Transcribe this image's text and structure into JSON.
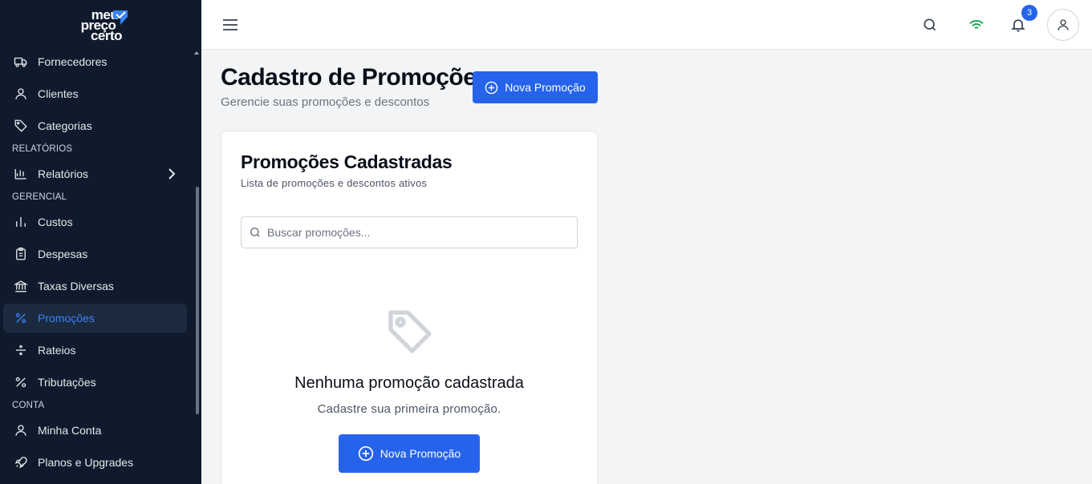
{
  "brand": {
    "line1": "meu",
    "line2": "preço",
    "line3": "certo"
  },
  "colors": {
    "sidebar": "#0f1b2d",
    "accent": "#2563eb",
    "active_text": "#3b82f6",
    "wifi": "#16a34a"
  },
  "sidebar": {
    "items": [
      {
        "label": "Fornecedores",
        "icon": "truck-icon"
      },
      {
        "label": "Clientes",
        "icon": "user-icon"
      },
      {
        "label": "Categorias",
        "icon": "tag-icon"
      },
      {
        "label": "Relatórios",
        "icon": "bar-chart-icon"
      },
      {
        "label": "Custos",
        "icon": "chart-icon"
      },
      {
        "label": "Despesas",
        "icon": "clipboard-icon"
      },
      {
        "label": "Taxas Diversas",
        "icon": "bank-icon"
      },
      {
        "label": "Promoções",
        "icon": "percent-icon",
        "active": true
      },
      {
        "label": "Rateios",
        "icon": "divide-icon"
      },
      {
        "label": "Tributações",
        "icon": "percent-icon"
      },
      {
        "label": "Minha Conta",
        "icon": "user-icon"
      },
      {
        "label": "Planos e Upgrades",
        "icon": "rocket-icon"
      }
    ],
    "sections": {
      "relatorios": "RELATÓRIOS",
      "gerencial": "GERENCIAL",
      "conta": "CONTA"
    }
  },
  "header": {
    "notification_count": "3"
  },
  "main": {
    "title": "Cadastro de Promoções",
    "subtitle": "Gerencie suas promoções e descontos",
    "new_button": "Nova Promoção",
    "card": {
      "title": "Promoções Cadastradas",
      "subtitle": "Lista de promoções e descontos ativos",
      "search_placeholder": "Buscar promoções...",
      "empty_title": "Nenhuma promoção cadastrada",
      "empty_subtitle": "Cadastre sua primeira promoção.",
      "empty_button": "Nova Promoção"
    }
  }
}
